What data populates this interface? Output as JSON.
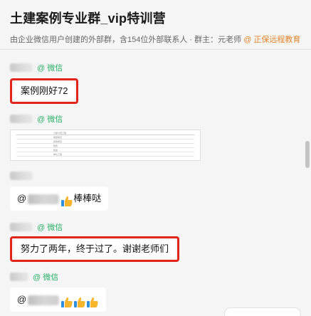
{
  "header": {
    "title": "土建案例专业群_vip特训营",
    "subtitle_main": "由企业微信用户创建的外部群，含154位外部联系人 · 群主：元老师",
    "subtitle_tag": "@ 正保远程教育"
  },
  "messages": [
    {
      "source": "@ 微信",
      "text": "案例刚好72"
    },
    {
      "source": "@ 微信",
      "doc_rows": [
        "分部分项工程",
        "措施项目",
        "其他项目",
        "规费",
        "税金",
        "单位工程"
      ]
    },
    {
      "source": "",
      "prefix": "@",
      "text": "棒棒哒"
    },
    {
      "source": "@ 微信",
      "text": "努力了两年，终于过了。谢谢老师们"
    },
    {
      "source": "@ 微信",
      "prefix": "@"
    }
  ],
  "icons": {
    "thumbs_up": "thumbs-up-icon"
  },
  "colors": {
    "accent_green": "#2aae67",
    "highlight_red": "#e1251b",
    "tag_orange": "#e0862b"
  }
}
